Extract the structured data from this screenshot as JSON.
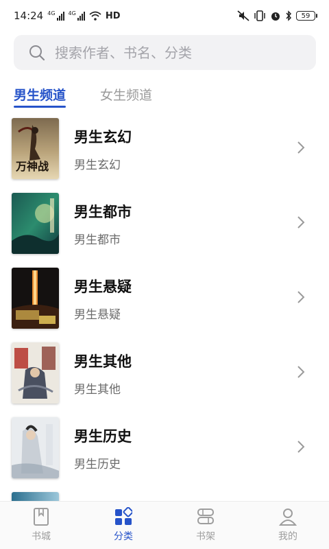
{
  "status_bar": {
    "time": "14:24",
    "signal_1": "4G",
    "signal_2": "4G",
    "hd": "HD",
    "battery": "59"
  },
  "search": {
    "placeholder": "搜索作者、书名、分类"
  },
  "tabs": [
    {
      "label": "男生频道",
      "active": true
    },
    {
      "label": "女生频道",
      "active": false
    }
  ],
  "categories": [
    {
      "title": "男生玄幻",
      "subtitle": "男生玄幻",
      "cover_text": "万神战"
    },
    {
      "title": "男生都市",
      "subtitle": "男生都市",
      "cover_text": ""
    },
    {
      "title": "男生悬疑",
      "subtitle": "男生悬疑",
      "cover_text": ""
    },
    {
      "title": "男生其他",
      "subtitle": "男生其他",
      "cover_text": ""
    },
    {
      "title": "男生历史",
      "subtitle": "男生历史",
      "cover_text": ""
    }
  ],
  "bottom_nav": [
    {
      "label": "书城",
      "icon": "bookstore-icon",
      "active": false
    },
    {
      "label": "分类",
      "icon": "category-icon",
      "active": true
    },
    {
      "label": "书架",
      "icon": "bookshelf-icon",
      "active": false
    },
    {
      "label": "我的",
      "icon": "profile-icon",
      "active": false
    }
  ],
  "colors": {
    "accent": "#2653c9",
    "inactive": "#9d9d9d"
  }
}
